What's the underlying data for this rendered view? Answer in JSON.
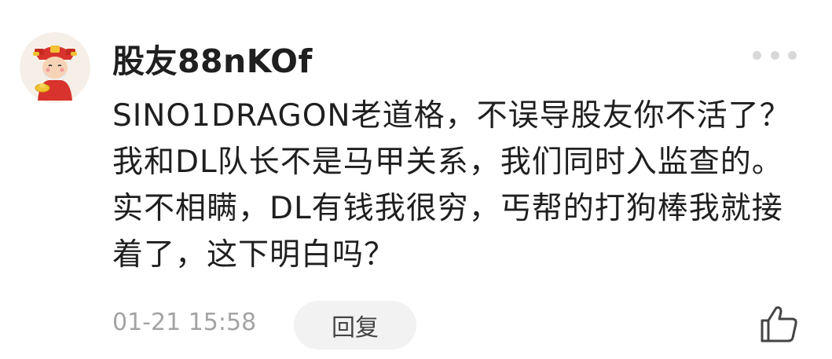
{
  "comment": {
    "username": "股友88nKOf",
    "content": "SINO1DRAGON老道格，不误导股友你不活了？我和DL队长不是马甲关系，我们同时入监查的。实不相瞒，DL有钱我很穷，丐帮的打狗棒我就接着了，这下明白吗？",
    "timestamp": "01-21 15:58",
    "reply_label": "回复"
  },
  "icons": {
    "avatar": "cartoon-fortune-god-avatar",
    "more": "more-dots-icon",
    "like": "thumbs-up-icon"
  },
  "colors": {
    "text": "#1f1f1f",
    "meta": "#a3a3a3",
    "reply_bg": "#f2f2f2",
    "dots": "#d8d8d8"
  }
}
